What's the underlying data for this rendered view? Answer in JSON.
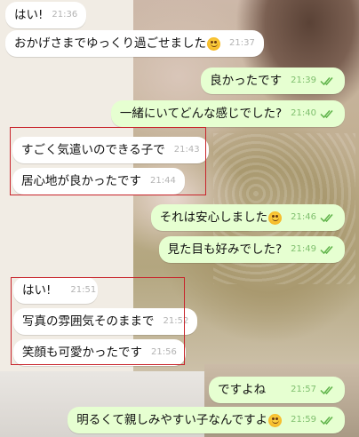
{
  "messages": [
    {
      "id": "m1",
      "dir": "in",
      "text": "はい!",
      "time": "21:36",
      "emoji": false
    },
    {
      "id": "m2",
      "dir": "in",
      "text": "おかげさまでゆっくり過ごせました",
      "time": "21:37",
      "emoji": true
    },
    {
      "id": "m3",
      "dir": "out",
      "text": "良かったです",
      "time": "21:39",
      "emoji": false
    },
    {
      "id": "m4",
      "dir": "out",
      "text": "一緒にいてどんな感じでした?",
      "time": "21:40",
      "emoji": false
    },
    {
      "id": "m5",
      "dir": "in",
      "text": "すごく気遣いのできる子で",
      "time": "21:43",
      "emoji": false
    },
    {
      "id": "m6",
      "dir": "in",
      "text": "居心地が良かったです",
      "time": "21:44",
      "emoji": false
    },
    {
      "id": "m7",
      "dir": "out",
      "text": "それは安心しました",
      "time": "21:46",
      "emoji": true
    },
    {
      "id": "m8",
      "dir": "out",
      "text": "見た目も好みでした?",
      "time": "21:49",
      "emoji": false
    },
    {
      "id": "m9",
      "dir": "in",
      "text": "はい!",
      "time": "21:51",
      "emoji": false
    },
    {
      "id": "m10",
      "dir": "in",
      "text": "写真の雰囲気そのままで",
      "time": "21:52",
      "emoji": false
    },
    {
      "id": "m11",
      "dir": "in",
      "text": "笑顔も可愛かったです",
      "time": "21:56",
      "emoji": false
    },
    {
      "id": "m12",
      "dir": "out",
      "text": "ですよね",
      "time": "21:57",
      "emoji": false
    },
    {
      "id": "m13",
      "dir": "out",
      "text": "明るくて親しみやすい子なんですよ",
      "time": "21:59",
      "emoji": true
    }
  ],
  "icons": {
    "read_receipt": "double-check-icon",
    "emoji": "smiling-face-icon"
  },
  "colors": {
    "incoming_bubble": "#ffffff",
    "outgoing_bubble": "#e6ffd1",
    "read_tick": "#5fb34a",
    "highlight_box": "#c8242b"
  }
}
